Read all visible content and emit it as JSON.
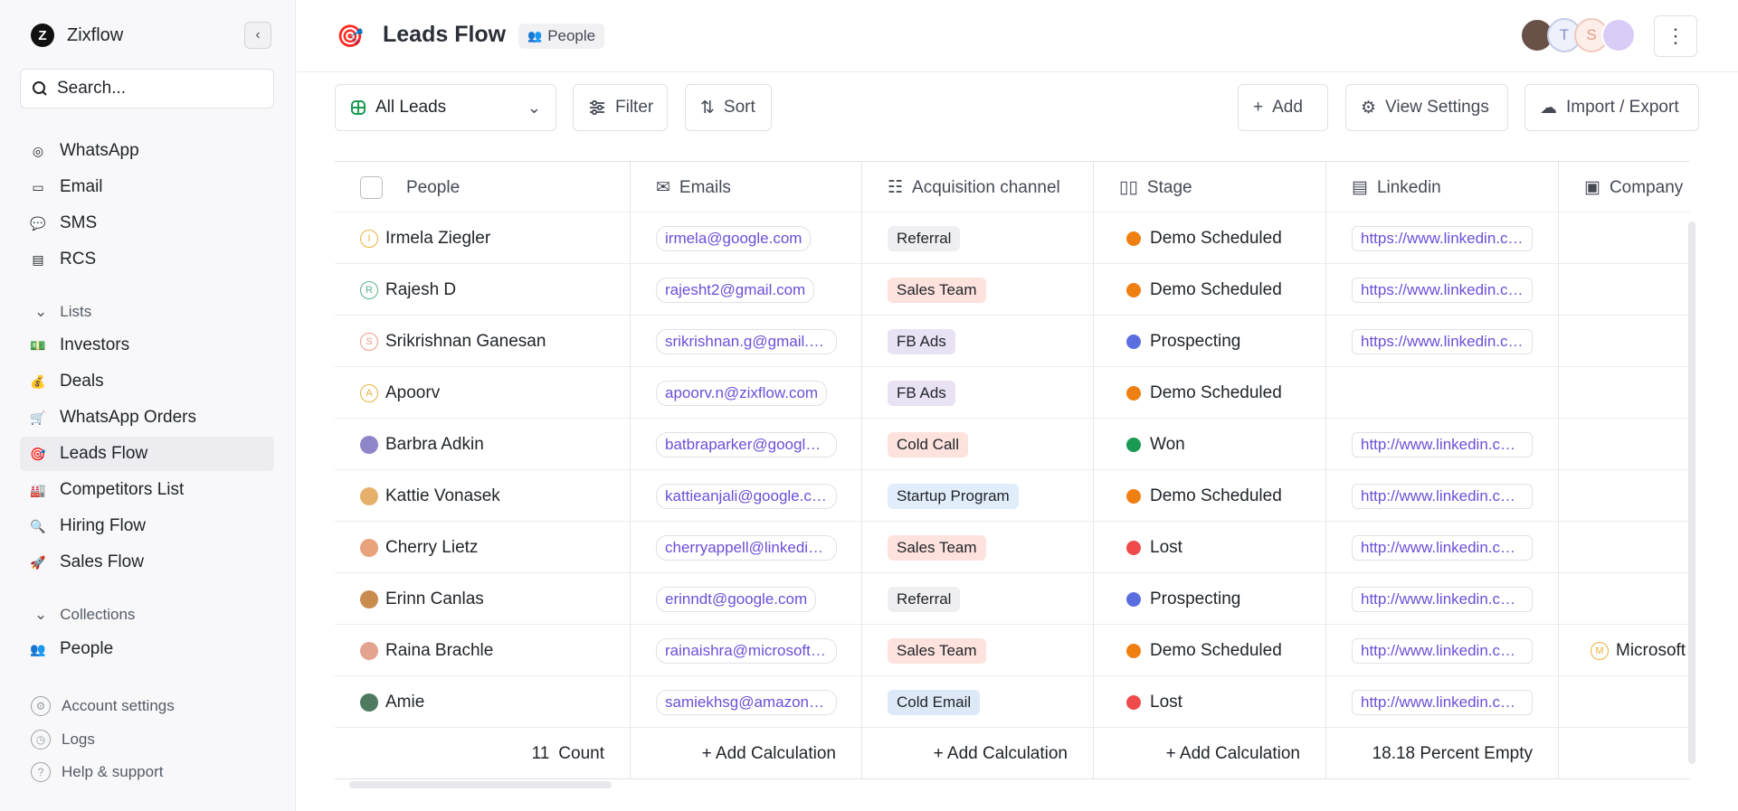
{
  "sidebar": {
    "brand": "Zixflow",
    "search_placeholder": "Search...",
    "channels": [
      {
        "label": "WhatsApp",
        "icon": "whatsapp-icon"
      },
      {
        "label": "Email",
        "icon": "email-icon"
      },
      {
        "label": "SMS",
        "icon": "sms-icon"
      },
      {
        "label": "RCS",
        "icon": "rcs-icon"
      }
    ],
    "lists_label": "Lists",
    "lists": [
      {
        "label": "Investors",
        "icon": "money-icon"
      },
      {
        "label": "Deals",
        "icon": "money-bag-icon"
      },
      {
        "label": "WhatsApp Orders",
        "icon": "cart-icon"
      },
      {
        "label": "Leads Flow",
        "icon": "target-icon"
      },
      {
        "label": "Competitors List",
        "icon": "factory-icon"
      },
      {
        "label": "Hiring Flow",
        "icon": "magnifier-icon"
      },
      {
        "label": "Sales Flow",
        "icon": "rocket-icon"
      }
    ],
    "collections_label": "Collections",
    "collections": [
      {
        "label": "People",
        "icon": "people-icon"
      }
    ],
    "bottom": [
      {
        "label": "Account settings",
        "icon": "gear-icon"
      },
      {
        "label": "Logs",
        "icon": "clock-icon"
      },
      {
        "label": "Help & support",
        "icon": "help-icon"
      }
    ]
  },
  "header": {
    "title": "Leads Flow",
    "badge": "People",
    "avatars": [
      "",
      "T",
      "S",
      ""
    ]
  },
  "toolbar": {
    "view": "All Leads",
    "filter": "Filter",
    "sort": "Sort",
    "add": "Add",
    "view_settings": "View Settings",
    "import_export": "Import / Export"
  },
  "table": {
    "columns": [
      "People",
      "Emails",
      "Acquisition channel",
      "Stage",
      "Linkedin",
      "Company"
    ],
    "rows": [
      {
        "name": "Irmela Ziegler",
        "initial": "I",
        "email": "irmela@google.com",
        "channel": "Referral",
        "stage": "Demo Scheduled",
        "linkedin": "https://www.linkedin.com/in/irmela",
        "company": ""
      },
      {
        "name": "Rajesh D",
        "initial": "R",
        "email": "rajesht2@gmail.com",
        "channel": "Sales Team",
        "stage": "Demo Scheduled",
        "linkedin": "https://www.linkedin.com/in/rajesh",
        "company": ""
      },
      {
        "name": "Srikrishnan Ganesan",
        "initial": "S",
        "email": "srikrishnan.g@gmail.com",
        "channel": "FB Ads",
        "stage": "Prospecting",
        "linkedin": "https://www.linkedin.com/in/srikrishnan",
        "company": ""
      },
      {
        "name": "Apoorv",
        "initial": "A",
        "email": "apoorv.n@zixflow.com",
        "channel": "FB Ads",
        "stage": "Demo Scheduled",
        "linkedin": "",
        "company": ""
      },
      {
        "name": "Barbra Adkin",
        "initial": "",
        "email": "batbraparker@google.com",
        "channel": "Cold Call",
        "stage": "Won",
        "linkedin": "http://www.linkedin.com/in/barbra",
        "company": ""
      },
      {
        "name": "Kattie Vonasek",
        "initial": "",
        "email": "kattieanjali@google.com",
        "channel": "Startup Program",
        "stage": "Demo Scheduled",
        "linkedin": "http://www.linkedin.com/in/kattie",
        "company": ""
      },
      {
        "name": "Cherry Lietz",
        "initial": "",
        "email": "cherryappell@linkedin.com",
        "channel": "Sales Team",
        "stage": "Lost",
        "linkedin": "http://www.linkedin.com/in/cherry",
        "company": ""
      },
      {
        "name": "Erinn Canlas",
        "initial": "",
        "email": "erinndt@google.com",
        "channel": "Referral",
        "stage": "Prospecting",
        "linkedin": "http://www.linkedin.com/in/erinn",
        "company": ""
      },
      {
        "name": "Raina Brachle",
        "initial": "",
        "email": "rainaishra@microsoft.com",
        "channel": "Sales Team",
        "stage": "Demo Scheduled",
        "linkedin": "http://www.linkedin.com/in/raina",
        "company": "Microsoft"
      },
      {
        "name": "Amie",
        "initial": "",
        "email": "samiekhsg@amazon.com",
        "channel": "Cold Email",
        "stage": "Lost",
        "linkedin": "http://www.linkedin.com/in/amie",
        "company": ""
      }
    ],
    "footer": {
      "count_value": "11",
      "count_label": "Count",
      "add_calc": "+ Add Calculation",
      "linkedin_stat": "18.18 Percent Empty"
    }
  },
  "colors": {
    "stage": {
      "Demo Scheduled": "#f07f12",
      "Prospecting": "#5b6ee0",
      "Won": "#1a9a52",
      "Lost": "#ef4b4b"
    },
    "channel": {
      "Referral": "#efeff2",
      "Sales Team": "#fde2dd",
      "FB Ads": "#e9e2f4",
      "Cold Call": "#fde2dd",
      "Startup Program": "#e1edfb",
      "Cold Email": "#dde9f7"
    },
    "accent": "#6b4fd8"
  }
}
